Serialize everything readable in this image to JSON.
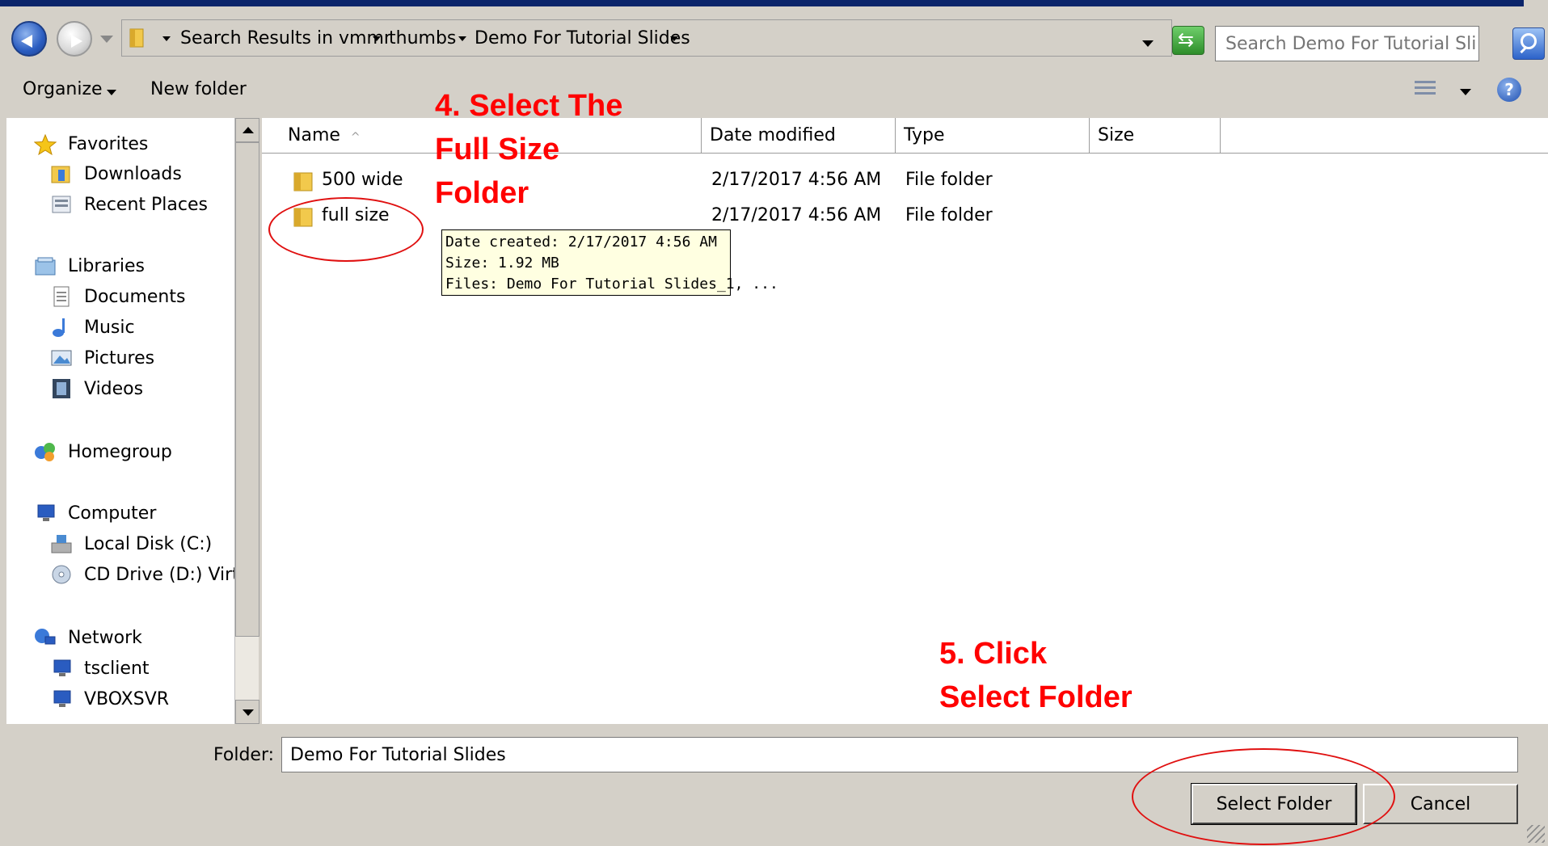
{
  "address_bar": {
    "crumbs": [
      "Search Results in vmmr",
      "thumbs",
      "Demo For Tutorial Slides"
    ],
    "search_placeholder": "Search Demo For Tutorial Slides"
  },
  "toolbar": {
    "organize_label": "Organize",
    "new_folder_label": "New folder"
  },
  "nav_pane": {
    "items": [
      {
        "label": "Favorites",
        "icon": "star-icon"
      },
      {
        "label": "Downloads",
        "icon": "downloads-folder-icon"
      },
      {
        "label": "Recent Places",
        "icon": "recent-places-icon"
      },
      {
        "label": "Libraries",
        "icon": "libraries-icon"
      },
      {
        "label": "Documents",
        "icon": "documents-icon"
      },
      {
        "label": "Music",
        "icon": "music-icon"
      },
      {
        "label": "Pictures",
        "icon": "pictures-icon"
      },
      {
        "label": "Videos",
        "icon": "videos-icon"
      },
      {
        "label": "Homegroup",
        "icon": "homegroup-icon"
      },
      {
        "label": "Computer",
        "icon": "computer-icon"
      },
      {
        "label": "Local Disk (C:)",
        "icon": "disk-icon"
      },
      {
        "label": "CD Drive (D:) Virtu",
        "icon": "cd-drive-icon"
      },
      {
        "label": "Network",
        "icon": "network-icon"
      },
      {
        "label": "tsclient",
        "icon": "computer-icon"
      },
      {
        "label": "VBOXSVR",
        "icon": "computer-icon"
      }
    ]
  },
  "file_list": {
    "columns": [
      "Name",
      "Date modified",
      "Type",
      "Size"
    ],
    "rows": [
      {
        "name": "500 wide",
        "date": "2/17/2017 4:56 AM",
        "type": "File folder"
      },
      {
        "name": "full size",
        "date": "2/17/2017 4:56 AM",
        "type": "File folder"
      }
    ]
  },
  "tooltip": {
    "lines": [
      "Date created: 2/17/2017 4:56 AM",
      "Size: 1.92 MB",
      "Files: Demo For Tutorial Slides_1, ..."
    ]
  },
  "footer": {
    "folder_label": "Folder:",
    "folder_value": "Demo For Tutorial Slides",
    "select_button": "Select Folder",
    "cancel_button": "Cancel"
  },
  "annotations": {
    "step4": [
      "4. Select The",
      "Full Size",
      "Folder"
    ],
    "step5": [
      "5. Click",
      "Select Folder"
    ],
    "color": "#ff0000"
  }
}
